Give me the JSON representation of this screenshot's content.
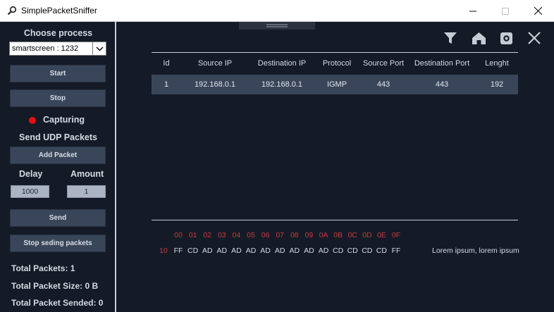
{
  "window": {
    "title": "SimplePacketSniffer",
    "controls": {
      "minimize": "minimize-icon",
      "maximize": "maximize-icon",
      "close": "close-icon"
    }
  },
  "sidebar": {
    "choose_process_label": "Choose process",
    "process_select_value": "smartscreen : 1232",
    "start_label": "Start",
    "stop_label": "Stop",
    "status_label": "Capturing",
    "status_color": "#e31010",
    "send_udp_label": "Send UDP Packets",
    "add_packet_label": "Add Packet",
    "delay_label": "Delay",
    "amount_label": "Amount",
    "delay_value": "1000",
    "amount_value": "1",
    "send_label": "Send",
    "stop_sending_label": "Stop seding packets",
    "total_packets": "Total Packets: 1",
    "total_packet_size": "Total Packet Size: 0 B",
    "total_packet_sended": "Total Packet Sended: 0"
  },
  "toolbar": {
    "icons": [
      "filter-icon",
      "home-icon",
      "settings-icon",
      "close-icon"
    ]
  },
  "table": {
    "columns": [
      "Id",
      "Source IP",
      "Destination IP",
      "Protocol",
      "Source Port",
      "Destination Port",
      "Lenght"
    ],
    "rows": [
      [
        "1",
        "192.168.0.1",
        "192.168.0.1",
        "IGMP",
        "443",
        "443",
        "192"
      ]
    ]
  },
  "hex": {
    "header": [
      "00",
      "01",
      "02",
      "03",
      "04",
      "05",
      "06",
      "07",
      "08",
      "09",
      "0A",
      "0B",
      "0C",
      "0D",
      "0E",
      "0F"
    ],
    "offset": "10",
    "bytes": [
      "FF",
      "CD",
      "AD",
      "AD",
      "AD",
      "AD",
      "AD",
      "AD",
      "AD",
      "AD",
      "AD",
      "CD",
      "CD",
      "CD",
      "CD",
      "FF"
    ],
    "ascii": "Lorem ipsum, lorem ipsum"
  },
  "colors": {
    "background": "#141b27",
    "button": "#39465a",
    "hex_header": "#c93a3a"
  }
}
